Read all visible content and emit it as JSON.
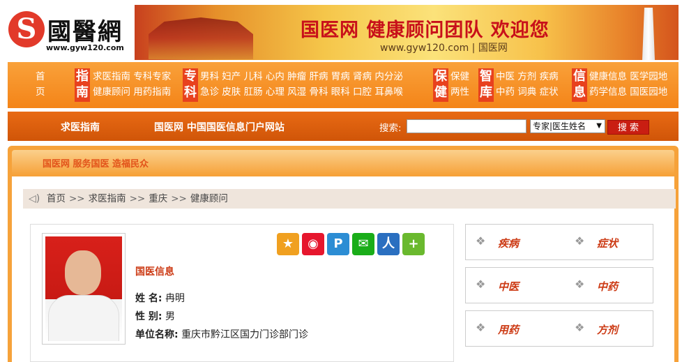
{
  "header": {
    "logo_mark": "S",
    "logo_text": "國醫網",
    "logo_url": "www.gyw120.com",
    "banner_slogan": "国医网 健康顾问团队 欢迎您",
    "banner_sub": "www.gyw120.com | 国医网"
  },
  "nav": {
    "col0": [
      "首",
      "页"
    ],
    "tag_guide": [
      "指",
      "南"
    ],
    "guide": [
      "求医指南 专科专家",
      "健康顾问 用药指南"
    ],
    "tag_special": [
      "专",
      "科"
    ],
    "special": [
      "男科 妇产 儿科 心内 肿瘤 肝病 胃病 肾病 内分泌",
      "急诊 皮肤 肛肠 心理 风湿 骨科 眼科 口腔 耳鼻喉"
    ],
    "tag_care": [
      "保",
      "健"
    ],
    "care": [
      "保健",
      "两性"
    ],
    "tag_wisdom": [
      "智",
      "库"
    ],
    "wisdom": [
      "中医 方剂 疾病",
      "中药 词典 症状"
    ],
    "tag_info": [
      "信",
      "息"
    ],
    "info": [
      "健康信息 医学园地",
      "药学信息 国医园地"
    ]
  },
  "searchbar": {
    "left_title": "求医指南",
    "site_title": "国医网 中国国医信息门户网站",
    "search_label": "搜索:",
    "search_value": "",
    "select_value": "专家|医生姓名",
    "button": "搜 索"
  },
  "frame": {
    "motto": "国医网 服务国医 造福民众"
  },
  "breadcrumb": {
    "items": [
      "首页",
      "求医指南",
      "重庆",
      "健康顾问"
    ],
    "sep": ">>"
  },
  "doctor": {
    "section_title": "国医信息",
    "name_label": "姓 名:",
    "name": "冉明",
    "gender_label": "性 别:",
    "gender": "男",
    "unit_label": "单位名称:",
    "unit": "重庆市黔江区国力门诊部门诊"
  },
  "share": [
    {
      "name": "qzone-icon",
      "glyph": "★",
      "color": "#f0a020"
    },
    {
      "name": "weibo-icon",
      "glyph": "◉",
      "color": "#e6162d"
    },
    {
      "name": "tencent-weibo-icon",
      "glyph": "P",
      "color": "#2c8dd4"
    },
    {
      "name": "wechat-icon",
      "glyph": "✉",
      "color": "#1aad19"
    },
    {
      "name": "renren-icon",
      "glyph": "人",
      "color": "#2a6fc0"
    },
    {
      "name": "more-icon",
      "glyph": "+",
      "color": "#6ab92e"
    }
  ],
  "side_tiles": [
    [
      "疾病",
      "症状"
    ],
    [
      "中医",
      "中药"
    ],
    [
      "用药",
      "方剂"
    ]
  ]
}
